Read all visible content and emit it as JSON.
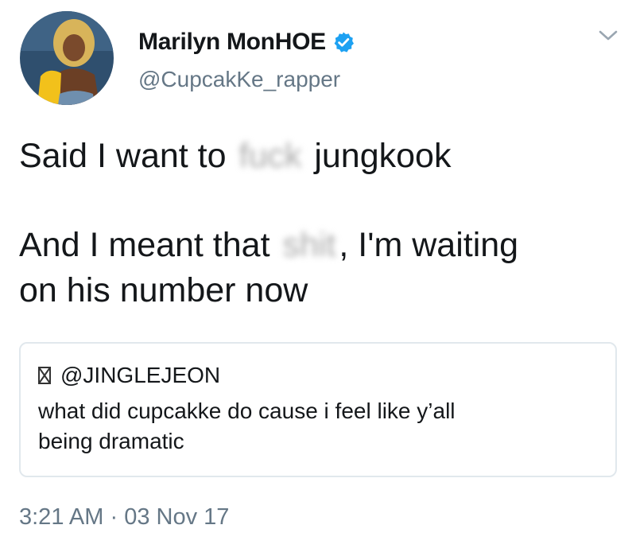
{
  "author": {
    "display_name": "Marilyn MonHOE",
    "handle": "@CupcakKe_rapper",
    "verified": true
  },
  "tweet": {
    "line1_before": "Said I want to ",
    "line1_censored": "fuck",
    "line1_after": " jungkook",
    "line2_before": "And I meant that ",
    "line2_censored": "shit",
    "line2_after": ", I'm waiting",
    "line3": "on his number now"
  },
  "quoted_tweet": {
    "handle": "@JINGLEJEON",
    "text_line1": "what did cupcakke do cause i feel like y’all",
    "text_line2": "being dramatic"
  },
  "footer": {
    "time": "3:21 AM",
    "separator": " · ",
    "date": "03 Nov 17"
  },
  "icons": {
    "verified": "verified-badge-icon",
    "menu": "chevron-down-icon",
    "unknown_glyph": "missing-glyph-icon"
  },
  "colors": {
    "text": "#14171a",
    "secondary_text": "#657786",
    "verified_blue": "#1da1f2",
    "border": "#e1e8ed"
  }
}
